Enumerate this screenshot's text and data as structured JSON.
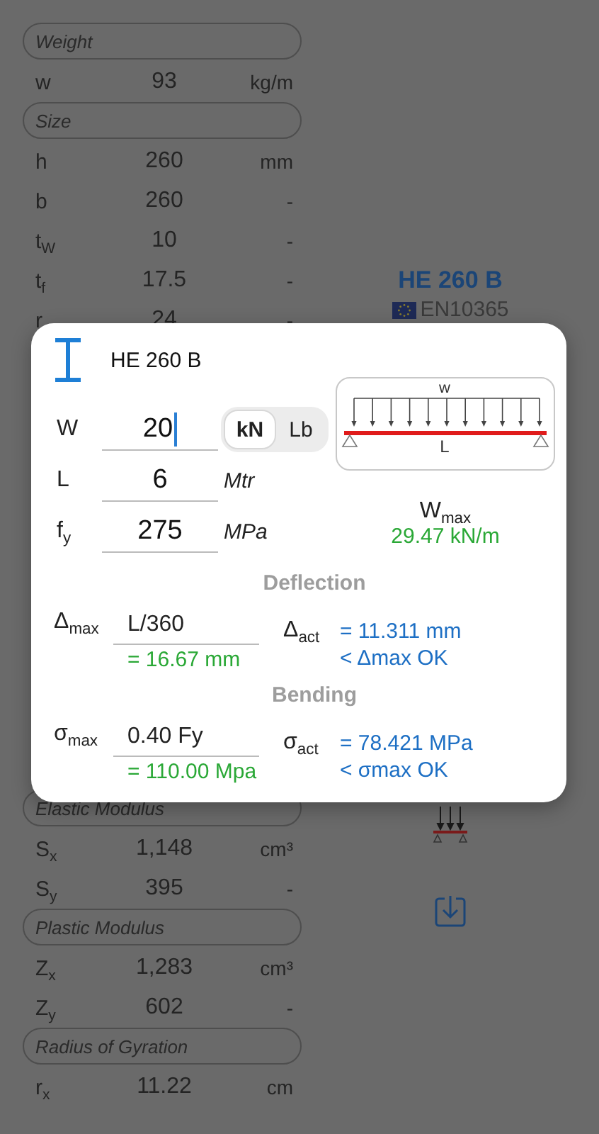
{
  "background": {
    "top_sections": [
      {
        "header": "Weight",
        "rows": [
          {
            "symbol": "w",
            "value": "93",
            "unit": "kg/m"
          }
        ]
      },
      {
        "header": "Size",
        "rows": [
          {
            "symbol": "h",
            "value": "260",
            "unit": "mm"
          },
          {
            "symbol": "b",
            "value": "260",
            "unit": "-"
          },
          {
            "symbol": "t$_{W}$",
            "value": "10",
            "unit": "-"
          },
          {
            "symbol": "t$_{f}$",
            "value": "17.5",
            "unit": "-"
          },
          {
            "symbol": "r",
            "value": "24",
            "unit": "-"
          }
        ]
      }
    ],
    "bottom_sections": [
      {
        "header": "Elastic Modulus",
        "rows": [
          {
            "symbol": "S$_{x}$",
            "value": "1,148",
            "unit": "cm³"
          },
          {
            "symbol": "S$_{y}$",
            "value": "395",
            "unit": "-"
          }
        ]
      },
      {
        "header": "Plastic Modulus",
        "rows": [
          {
            "symbol": "Z$_{x}$",
            "value": "1,283",
            "unit": "cm³"
          },
          {
            "symbol": "Z$_{y}$",
            "value": "602",
            "unit": "-"
          }
        ]
      },
      {
        "header": "Radius of Gyration",
        "rows": [
          {
            "symbol": "r$_{x}$",
            "value": "11.22",
            "unit": "cm"
          }
        ]
      }
    ],
    "profile_name": "HE 260 B",
    "standard": "EN10365"
  },
  "dialog": {
    "title": "HE 260 B",
    "inputs": [
      {
        "label": "W",
        "value": "20",
        "focused": true,
        "units": [
          {
            "label": "kN",
            "selected": true
          },
          {
            "label": "Lb",
            "selected": false
          }
        ]
      },
      {
        "label": "L",
        "value": "6",
        "focused": false,
        "unit": "Mtr"
      },
      {
        "label": "f$_{y}$",
        "value": "275",
        "focused": false,
        "unit": "MPa"
      }
    ],
    "diagram": {
      "load_label": "w",
      "span_label": "L"
    },
    "capacity": {
      "label": "W$_{max}$",
      "value": "29.47 kN/m"
    },
    "checks": [
      {
        "title": "Deflection",
        "limit_label": "Δ$_{max}$",
        "limit_value": "L/360",
        "limit_result": "= 16.67 mm",
        "actual_label": "Δ$_{act}$",
        "actual_value": "= 11.311 mm",
        "status": "< Δmax OK"
      },
      {
        "title": "Bending",
        "limit_label": "σ$_{max}$",
        "limit_value": "0.40 Fy",
        "limit_result": "= 110.00 Mpa",
        "actual_label": "σ$_{act}$",
        "actual_value": "= 78.421 MPa",
        "status": "< σmax OK"
      }
    ]
  }
}
